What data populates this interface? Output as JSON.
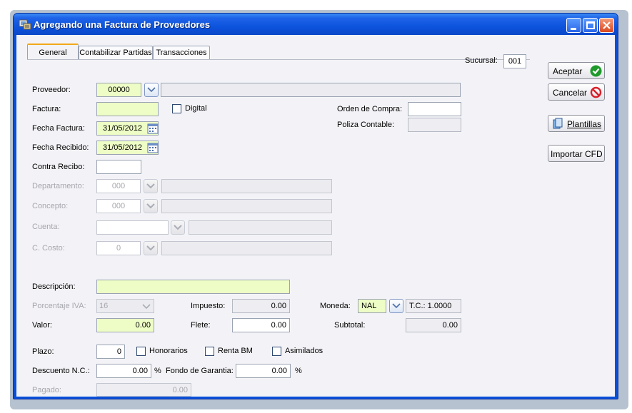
{
  "window": {
    "title": "Agregando una Factura de Proveedores"
  },
  "tabs": [
    {
      "label": "General",
      "active": true
    },
    {
      "label": "Contabilizar Partidas",
      "active": false
    },
    {
      "label": "Transacciones",
      "active": false
    }
  ],
  "sucursal": {
    "label": "Sucursal:",
    "value": "001"
  },
  "buttons": {
    "aceptar": "Aceptar",
    "cancelar": "Cancelar",
    "plantillas": "Plantillas",
    "importar": "Importar CFD"
  },
  "form": {
    "proveedor": {
      "label": "Proveedor:",
      "code": "00000",
      "name": ""
    },
    "factura": {
      "label": "Factura:",
      "value": ""
    },
    "digital": {
      "label": "Digital",
      "checked": false
    },
    "orden_compra": {
      "label": "Orden de Compra:",
      "value": ""
    },
    "poliza_contable": {
      "label": "Poliza Contable:",
      "value": ""
    },
    "fecha_factura": {
      "label": "Fecha Factura:",
      "value": "31/05/2012"
    },
    "fecha_recibido": {
      "label": "Fecha Recibido:",
      "value": "31/05/2012"
    },
    "contra_recibo": {
      "label": "Contra Recibo:",
      "value": ""
    },
    "departamento": {
      "label": "Departamento:",
      "code": "000",
      "name": ""
    },
    "concepto": {
      "label": "Concepto:",
      "code": "000",
      "name": ""
    },
    "cuenta": {
      "label": "Cuenta:",
      "code": "",
      "name": ""
    },
    "c_costo": {
      "label": "C. Costo:",
      "code": "0",
      "name": ""
    },
    "descripcion": {
      "label": "Descripción:",
      "value": ""
    },
    "porcentaje_iva": {
      "label": "Porcentaje IVA:",
      "value": "16"
    },
    "impuesto": {
      "label": "Impuesto:",
      "value": "0.00"
    },
    "moneda": {
      "label": "Moneda:",
      "value": "NAL",
      "tc": "T.C.: 1.0000"
    },
    "valor": {
      "label": "Valor:",
      "value": "0.00"
    },
    "flete": {
      "label": "Flete:",
      "value": "0.00"
    },
    "subtotal": {
      "label": "Subtotal:",
      "value": "0.00"
    },
    "plazo": {
      "label": "Plazo:",
      "value": "0"
    },
    "honorarios": {
      "label": "Honorarios",
      "checked": false
    },
    "renta_bm": {
      "label": "Renta BM",
      "checked": false
    },
    "asimilados": {
      "label": "Asimilados",
      "checked": false
    },
    "descuento_nc": {
      "label": "Descuento N.C.:",
      "value": "0.00",
      "unit": "%"
    },
    "fondo_garantia": {
      "label": "Fondo de Garantia:",
      "value": "0.00",
      "unit": "%"
    },
    "pagado": {
      "label": "Pagado:",
      "value": "0.00"
    }
  },
  "colors": {
    "title_bar": "#0d54de",
    "required_field": "#eefdc6",
    "readonly_field": "#ececf0",
    "active_tab_accent": "#f2a91b"
  }
}
